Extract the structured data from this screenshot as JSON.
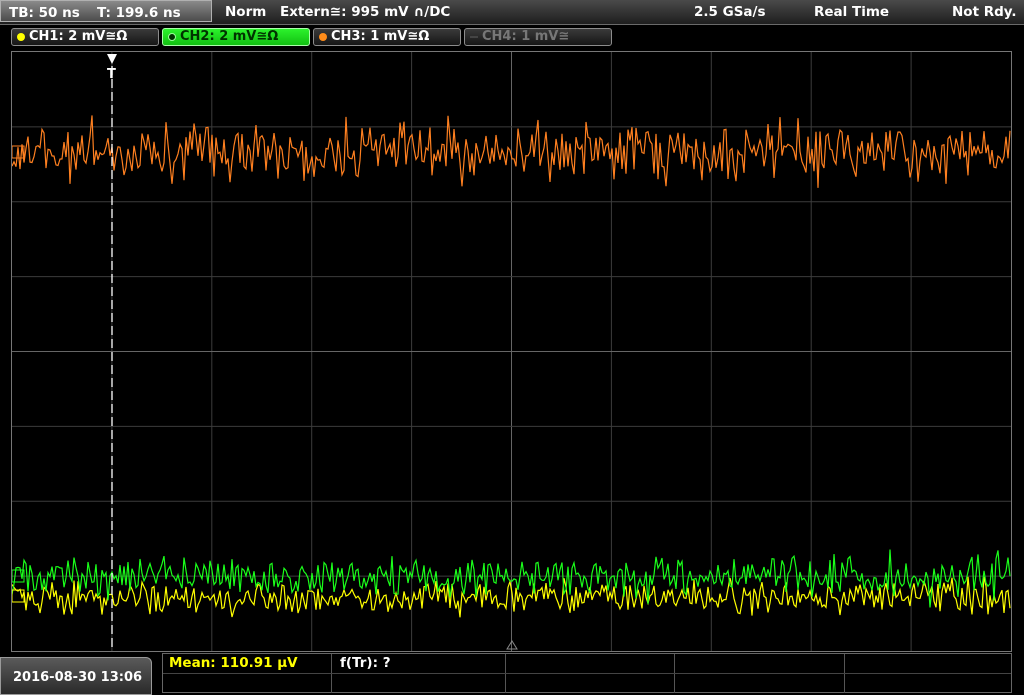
{
  "header": {
    "tb_label": "TB: 50 ns",
    "t_label": "T: 199.6 ns",
    "mode": "Norm",
    "trigger": "Extern≅: 995 mV ∩/DC",
    "sample_rate": "2.5 GSa/s",
    "acq_mode": "Real Time",
    "status": "Not Rdy."
  },
  "channels": [
    {
      "label": "CH1: 2 mV≅Ω",
      "color": "#ffff00",
      "active": false
    },
    {
      "label": "CH2: 2 mV≅Ω",
      "color": "#00ff00",
      "active": true
    },
    {
      "label": "CH3: 1 mV≅Ω",
      "color": "#ff8c1a",
      "active": false
    },
    {
      "label": "CH4: 1 mV≅",
      "color": "#777777",
      "active": false
    }
  ],
  "trigger_marker": "T",
  "measurement": {
    "mean": "Mean: 110.91 µV",
    "ftr": "f(Tr): ?"
  },
  "datetime": "2016-08-30 13:06",
  "colors": {
    "ch1": "#ffff00",
    "ch2": "#1aff1a",
    "ch3": "#ff8020",
    "grid": "#555555",
    "active_tab": "#22dd22"
  }
}
